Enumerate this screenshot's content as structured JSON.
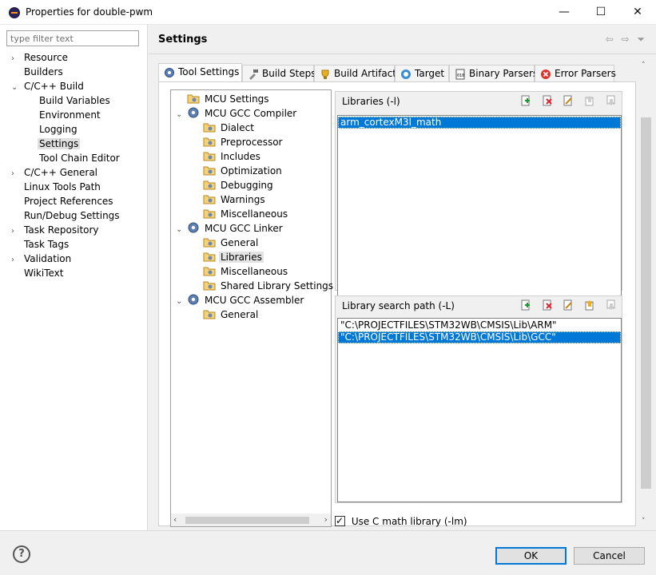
{
  "window": {
    "title": "Properties for double-pwm",
    "minimize": "—",
    "maximize": "☐",
    "close": "✕"
  },
  "filter": {
    "placeholder": "type filter text"
  },
  "nav_tree": [
    {
      "label": "Resource",
      "chevron": "›"
    },
    {
      "label": "Builders",
      "chevron": ""
    },
    {
      "label": "C/C++ Build",
      "chevron": "⌄"
    },
    {
      "label": "Build Variables",
      "chevron": ""
    },
    {
      "label": "Environment",
      "chevron": ""
    },
    {
      "label": "Logging",
      "chevron": ""
    },
    {
      "label": "Settings",
      "chevron": "",
      "selected": true
    },
    {
      "label": "Tool Chain Editor",
      "chevron": ""
    },
    {
      "label": "C/C++ General",
      "chevron": "›"
    },
    {
      "label": "Linux Tools Path",
      "chevron": ""
    },
    {
      "label": "Project References",
      "chevron": ""
    },
    {
      "label": "Run/Debug Settings",
      "chevron": ""
    },
    {
      "label": "Task Repository",
      "chevron": "›"
    },
    {
      "label": "Task Tags",
      "chevron": ""
    },
    {
      "label": "Validation",
      "chevron": "›"
    },
    {
      "label": "WikiText",
      "chevron": ""
    }
  ],
  "page": {
    "title": "Settings",
    "nav_back": "⇦",
    "nav_forward": "⇨",
    "menu": "⏷"
  },
  "tabs": [
    {
      "label": "Tool Settings",
      "active": true
    },
    {
      "label": "Build Steps"
    },
    {
      "label": "Build Artifact"
    },
    {
      "label": "Target"
    },
    {
      "label": "Binary Parsers"
    },
    {
      "label": "Error Parsers"
    }
  ],
  "tool_tree": [
    {
      "label": "MCU Settings",
      "chevron": ""
    },
    {
      "label": "MCU GCC Compiler",
      "chevron": "⌄"
    },
    {
      "label": "Dialect",
      "chevron": ""
    },
    {
      "label": "Preprocessor",
      "chevron": ""
    },
    {
      "label": "Includes",
      "chevron": ""
    },
    {
      "label": "Optimization",
      "chevron": ""
    },
    {
      "label": "Debugging",
      "chevron": ""
    },
    {
      "label": "Warnings",
      "chevron": ""
    },
    {
      "label": "Miscellaneous",
      "chevron": ""
    },
    {
      "label": "MCU GCC Linker",
      "chevron": "⌄"
    },
    {
      "label": "General",
      "chevron": ""
    },
    {
      "label": "Libraries",
      "chevron": "",
      "selected": true
    },
    {
      "label": "Miscellaneous",
      "chevron": ""
    },
    {
      "label": "Shared Library Settings",
      "chevron": ""
    },
    {
      "label": "MCU GCC Assembler",
      "chevron": "⌄"
    },
    {
      "label": "General",
      "chevron": ""
    }
  ],
  "scroll": {
    "left": "‹",
    "right": "›",
    "up": "˄",
    "down": "˅"
  },
  "libraries": {
    "title": "Libraries (-l)",
    "items": [
      "arm_cortexM3l_math"
    ]
  },
  "library_paths": {
    "title": "Library search path (-L)",
    "items": [
      "\"C:\\PROJECTFILES\\STM32WB\\CMSIS\\Lib\\ARM\"",
      "\"C:\\PROJECTFILES\\STM32WB\\CMSIS\\Lib\\GCC\""
    ]
  },
  "math_option": {
    "label": "Use C math library (-lm)",
    "checked": true
  },
  "buttons": {
    "help": "?",
    "ok": "OK",
    "cancel": "Cancel"
  }
}
